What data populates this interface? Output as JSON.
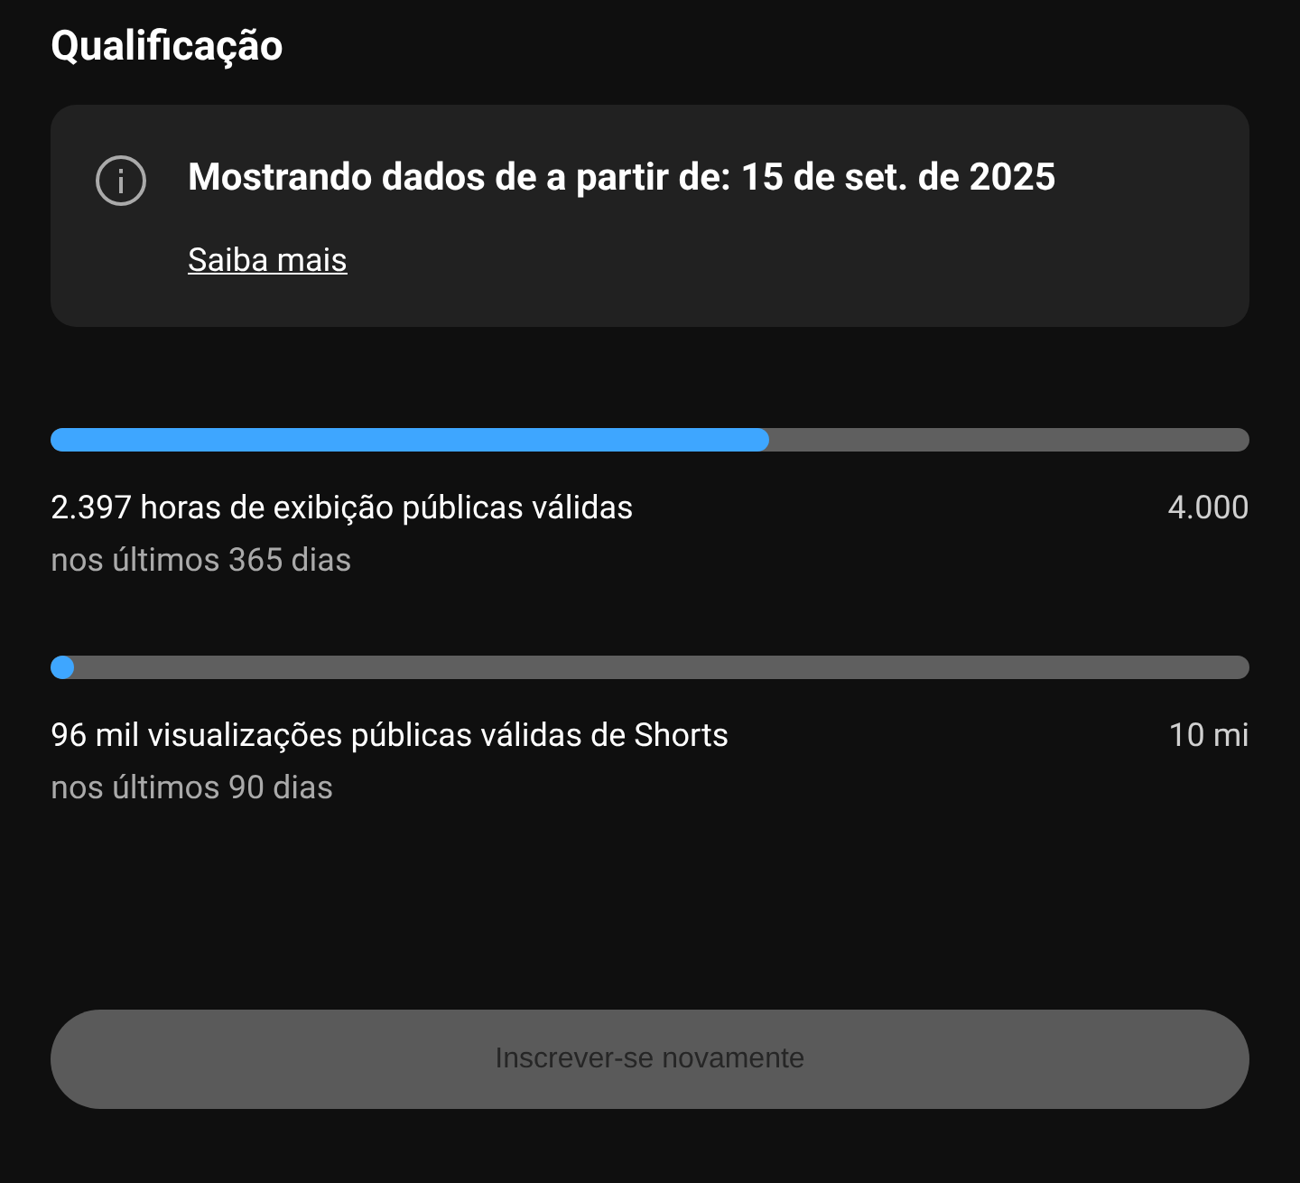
{
  "title": "Qualificação",
  "notice": {
    "text": "Mostrando dados de a partir de: 15 de set. de 2025",
    "link": "Saiba mais"
  },
  "requirements": [
    {
      "label": "2.397 horas de exibição públicas válidas",
      "period": "nos últimos 365 dias",
      "target": "4.000",
      "level": 0.6
    },
    {
      "label": "96 mil visualizações públicas válidas de Shorts",
      "period": "nos últimos 90 dias",
      "target": "10 mi",
      "level": 0.02
    }
  ],
  "button": {
    "label": "Inscrever-se novamente",
    "disabled": true
  }
}
